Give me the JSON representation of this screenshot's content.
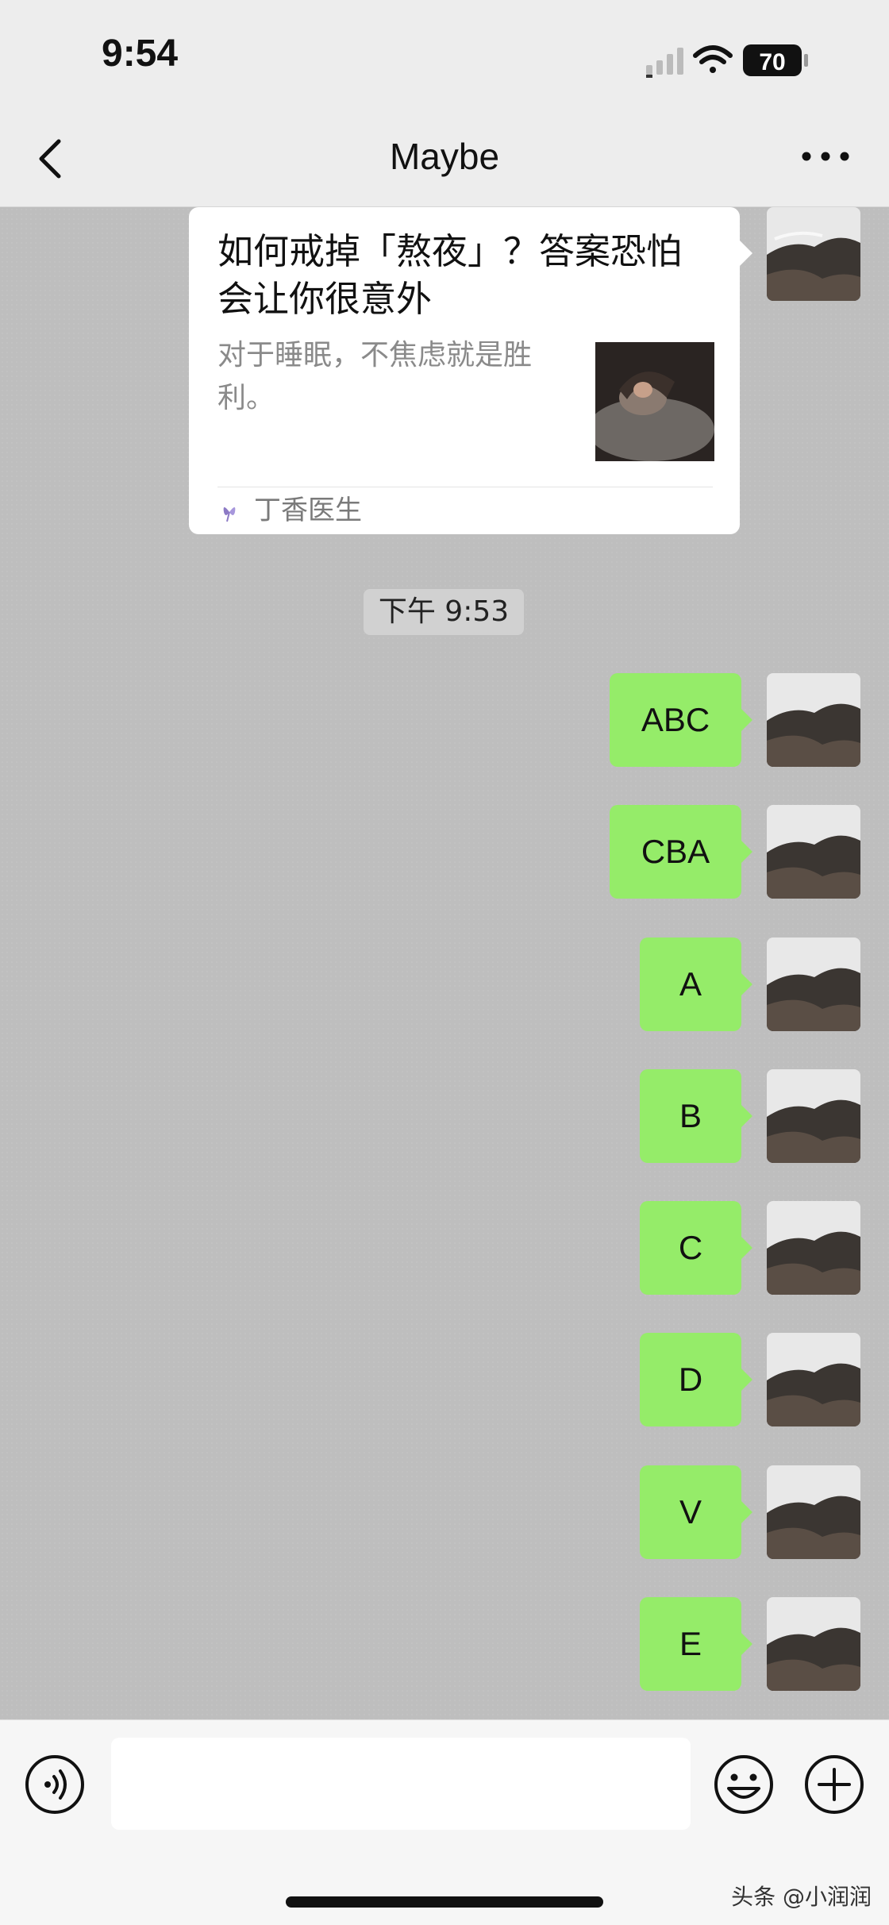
{
  "status": {
    "time": "9:54",
    "battery": "70",
    "icons": [
      "cellular-signal-icon",
      "wifi-icon",
      "battery-icon"
    ]
  },
  "nav": {
    "title": "Maybe",
    "icons": [
      "back-chevron-icon",
      "more-icon"
    ]
  },
  "card": {
    "title": "如何戒掉「熬夜」？答案恐怕会让你很意外",
    "description": "对于睡眠，不焦虑就是胜利。",
    "source": "丁香医生",
    "icons": [
      "source-logo-icon",
      "article-thumbnail"
    ]
  },
  "timestamp": "下午 9:53",
  "messages": [
    "ABC",
    "CBA",
    "A",
    "B",
    "C",
    "D",
    "V",
    "E"
  ],
  "input": {
    "value": "",
    "icons": [
      "voice-icon",
      "emoji-icon",
      "plus-icon"
    ]
  },
  "watermark": "头条 @小润润",
  "colors": {
    "bubble": "#95ec69",
    "chat_background": "#bebebe",
    "bar_background": "#ededed"
  }
}
